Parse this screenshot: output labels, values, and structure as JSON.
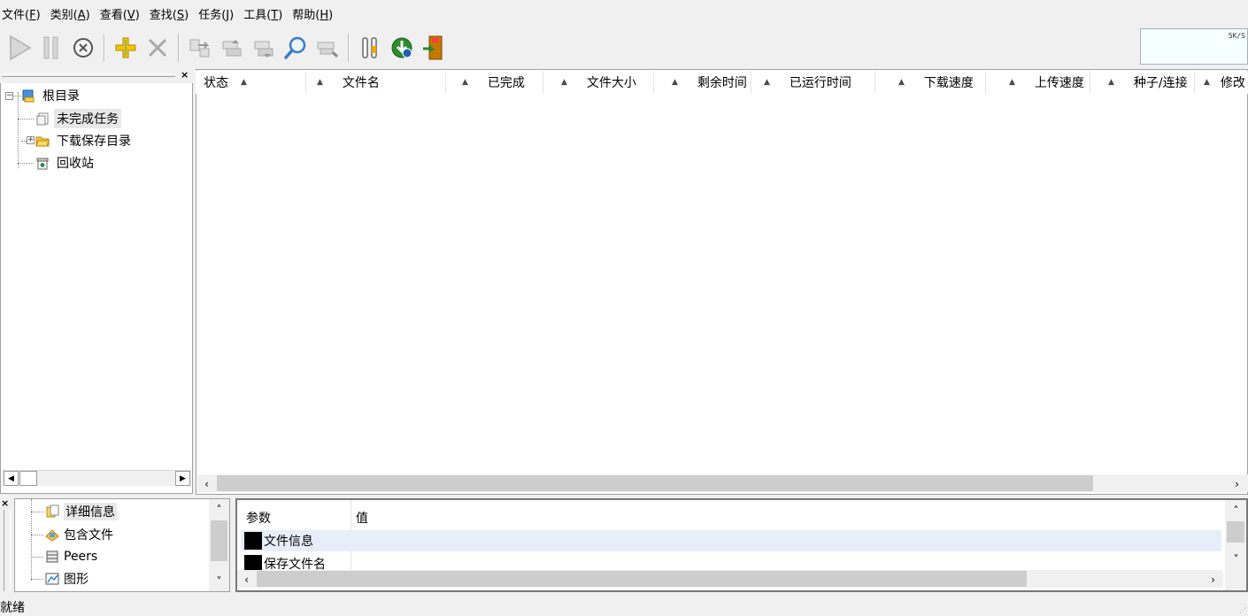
{
  "menu": [
    {
      "label": "文件(",
      "accel": "F",
      "suffix": ")"
    },
    {
      "label": "类别(",
      "accel": "A",
      "suffix": ")"
    },
    {
      "label": "查看(",
      "accel": "V",
      "suffix": ")"
    },
    {
      "label": "查找(",
      "accel": "S",
      "suffix": ")"
    },
    {
      "label": "任务(",
      "accel": "J",
      "suffix": ")"
    },
    {
      "label": "工具(",
      "accel": "T",
      "suffix": ")"
    },
    {
      "label": "帮助(",
      "accel": "H",
      "suffix": ")"
    }
  ],
  "toolbar": {
    "speed_text": "5K/S",
    "icons": [
      "play-icon",
      "pause-icon",
      "stop-icon",
      "add-icon",
      "delete-icon",
      "move-icon",
      "move-up-icon",
      "move-down-icon",
      "search-icon",
      "find-next-icon",
      "settings-icon",
      "update-icon",
      "exit-icon"
    ],
    "colors": {
      "add": "#f5c400",
      "update": "#2e8b2e",
      "exit": "#c47a00"
    }
  },
  "tree": {
    "root": "根目录",
    "items": [
      "未完成任务",
      "下载保存目录",
      "回收站"
    ]
  },
  "columns": [
    "状态",
    "文件名",
    "已完成",
    "文件大小",
    "剩余时间",
    "已运行时间",
    "下载速度",
    "上传速度",
    "种子/连接",
    "修改"
  ],
  "bottom_tree": {
    "items": [
      "详细信息",
      "包含文件",
      "Peers",
      "图形"
    ]
  },
  "detail": {
    "headers": {
      "param": "参数",
      "value": "值"
    },
    "rows": [
      "文件信息",
      "保存文件名"
    ]
  },
  "status": {
    "text": "就绪"
  }
}
